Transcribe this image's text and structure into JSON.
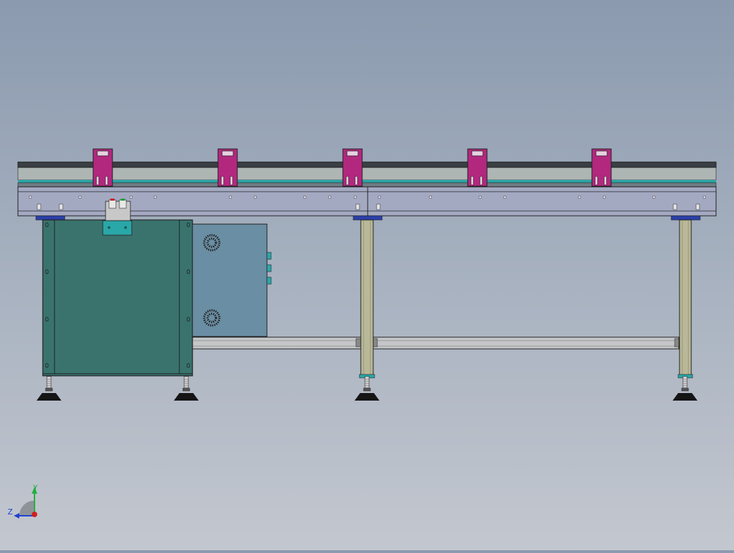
{
  "colors": {
    "rail": "#aeb6b4",
    "rail_band": "#2aa7a8",
    "beam": "#a4a9c2",
    "clamp": "#b2287f",
    "cabinet": "#3a736e",
    "control_box": "#6a8ea3",
    "leg": "#b9b898",
    "crossbar": "#c4c6c8",
    "foot": "#151515",
    "outline": "#202020"
  },
  "clamps": [
    "clamp-1",
    "clamp-2",
    "clamp-3",
    "clamp-4",
    "clamp-5"
  ],
  "axes": {
    "y_label": "Y",
    "z_label": "Z"
  }
}
